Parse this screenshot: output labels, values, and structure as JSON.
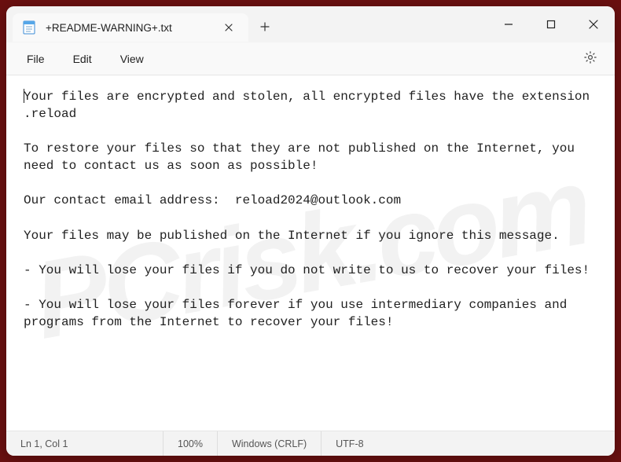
{
  "titlebar": {
    "tab_title": "+README-WARNING+.txt"
  },
  "menu": {
    "file": "File",
    "edit": "Edit",
    "view": "View"
  },
  "document": {
    "text": "Your files are encrypted and stolen, all encrypted files have the extension .reload\n\nTo restore your files so that they are not published on the Internet, you need to contact us as soon as possible!\n\nOur contact email address:  reload2024@outlook.com\n\nYour files may be published on the Internet if you ignore this message.\n\n- You will lose your files if you do not write to us to recover your files!\n\n- You will lose your files forever if you use intermediary companies and programs from the Internet to recover your files!"
  },
  "status": {
    "position": "Ln 1, Col 1",
    "zoom": "100%",
    "line_ending": "Windows (CRLF)",
    "encoding": "UTF-8"
  },
  "watermark": "PCrisk.com"
}
